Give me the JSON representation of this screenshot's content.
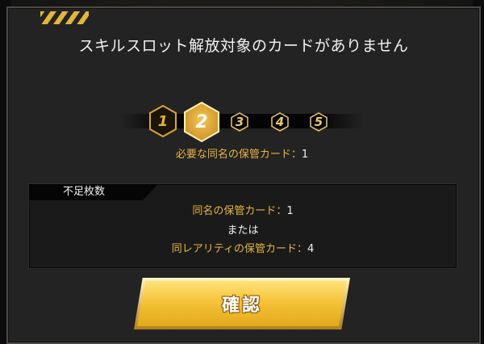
{
  "dialog": {
    "title": "スキルスロット解放対象のカードがありません"
  },
  "skill_slots": [
    {
      "label": "1",
      "state": "unlocked"
    },
    {
      "label": "2",
      "state": "selected"
    },
    {
      "label": "3",
      "state": "locked"
    },
    {
      "label": "4",
      "state": "locked"
    },
    {
      "label": "5",
      "state": "locked"
    }
  ],
  "requirement": {
    "label": "必要な同名の保管カード",
    "separator": "：",
    "value": "1"
  },
  "shortage": {
    "header": "不足枚数",
    "line1_label": "同名の保管カード",
    "line1_sep": "：",
    "line1_value": "1",
    "or_text": "または",
    "line2_label": "同レアリティの保管カード",
    "line2_sep": "：",
    "line2_value": "4"
  },
  "confirm_button": {
    "label": "確認"
  },
  "colors": {
    "accent_gold": "#e6b545",
    "button_gold": "#f6c339",
    "panel_bg": "#242323",
    "text_white": "#f0f0f0"
  }
}
